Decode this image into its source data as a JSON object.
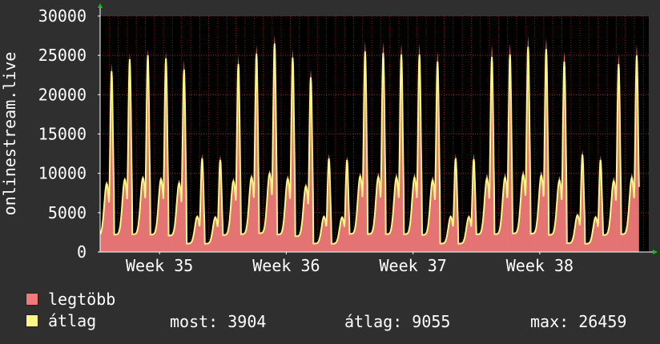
{
  "chart_data": {
    "type": "area",
    "ylabel": "onlinestream.live",
    "ylim": [
      0,
      30000
    ],
    "yticks": [
      0,
      5000,
      10000,
      15000,
      20000,
      25000,
      30000
    ],
    "xticks": [
      "Week 35",
      "Week 36",
      "Week 37",
      "Week 38"
    ],
    "grid": true,
    "legend_position": "bottom-left",
    "x_unit": "day",
    "series": [
      {
        "name": "legtöbb",
        "color": "#f07a7a",
        "style": "area",
        "daily_peaks": [
          24000,
          25300,
          25800,
          25500,
          24400,
          12500,
          12300,
          25000,
          26300,
          27600,
          25800,
          23200,
          12500,
          12200,
          26800,
          26700,
          26500,
          26500,
          25500,
          12500,
          12500,
          26300,
          26500,
          27500,
          27200,
          25500,
          13000,
          12300,
          25200,
          26400
        ]
      },
      {
        "name": "átlag",
        "color": "#fff685",
        "style": "line",
        "daily_peaks": [
          23000,
          24500,
          25000,
          24600,
          23200,
          11900,
          11700,
          23900,
          25200,
          26500,
          24700,
          22200,
          11900,
          11700,
          25500,
          25300,
          25100,
          25100,
          24200,
          11900,
          11800,
          24800,
          25100,
          26100,
          25800,
          24200,
          12400,
          11700,
          23900,
          25000
        ]
      }
    ]
  },
  "legend": [
    {
      "label": "legtöbb",
      "color": "#f07a7a"
    },
    {
      "label": "átlag",
      "color": "#fff685"
    }
  ],
  "stats": {
    "most": "most: 3904",
    "atlag": "átlag: 9055",
    "max": "max: 26459"
  }
}
